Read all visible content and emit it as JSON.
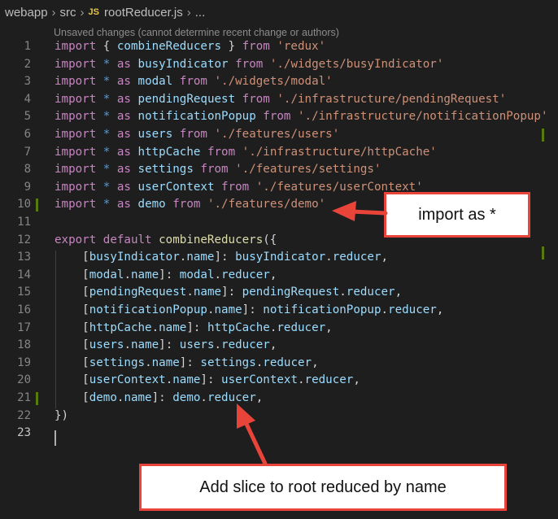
{
  "breadcrumb": {
    "items": [
      "webapp",
      "src",
      "rootReducer.js",
      "..."
    ],
    "file_icon": "JS"
  },
  "blame_text": "Unsaved changes (cannot determine recent change or authors)",
  "colors": {
    "background": "#1e1e1e",
    "keyword": "#c586c0",
    "builtin": "#569cd6",
    "string": "#ce9178",
    "variable": "#9cdcfe",
    "function": "#dcdcaa",
    "modified_gutter": "#587c0c",
    "callout_border": "#e8443a"
  },
  "lines": [
    {
      "n": "1",
      "tokens": [
        [
          "kw",
          "import"
        ],
        [
          "plain",
          " { "
        ],
        [
          "var",
          "combineReducers"
        ],
        [
          "plain",
          " } "
        ],
        [
          "kw",
          "from"
        ],
        [
          "plain",
          " "
        ],
        [
          "str",
          "'redux'"
        ]
      ]
    },
    {
      "n": "2",
      "tokens": [
        [
          "kw",
          "import"
        ],
        [
          "plain",
          " "
        ],
        [
          "blue",
          "*"
        ],
        [
          "plain",
          " "
        ],
        [
          "kw",
          "as"
        ],
        [
          "plain",
          " "
        ],
        [
          "var",
          "busyIndicator"
        ],
        [
          "plain",
          " "
        ],
        [
          "kw",
          "from"
        ],
        [
          "plain",
          " "
        ],
        [
          "str",
          "'./widgets/busyIndicator'"
        ]
      ]
    },
    {
      "n": "3",
      "tokens": [
        [
          "kw",
          "import"
        ],
        [
          "plain",
          " "
        ],
        [
          "blue",
          "*"
        ],
        [
          "plain",
          " "
        ],
        [
          "kw",
          "as"
        ],
        [
          "plain",
          " "
        ],
        [
          "var",
          "modal"
        ],
        [
          "plain",
          " "
        ],
        [
          "kw",
          "from"
        ],
        [
          "plain",
          " "
        ],
        [
          "str",
          "'./widgets/modal'"
        ]
      ]
    },
    {
      "n": "4",
      "tokens": [
        [
          "kw",
          "import"
        ],
        [
          "plain",
          " "
        ],
        [
          "blue",
          "*"
        ],
        [
          "plain",
          " "
        ],
        [
          "kw",
          "as"
        ],
        [
          "plain",
          " "
        ],
        [
          "var",
          "pendingRequest"
        ],
        [
          "plain",
          " "
        ],
        [
          "kw",
          "from"
        ],
        [
          "plain",
          " "
        ],
        [
          "str",
          "'./infrastructure/pendingRequest'"
        ]
      ]
    },
    {
      "n": "5",
      "tokens": [
        [
          "kw",
          "import"
        ],
        [
          "plain",
          " "
        ],
        [
          "blue",
          "*"
        ],
        [
          "plain",
          " "
        ],
        [
          "kw",
          "as"
        ],
        [
          "plain",
          " "
        ],
        [
          "var",
          "notificationPopup"
        ],
        [
          "plain",
          " "
        ],
        [
          "kw",
          "from"
        ],
        [
          "plain",
          " "
        ],
        [
          "str",
          "'./infrastructure/notificationPopup'"
        ]
      ]
    },
    {
      "n": "6",
      "tokens": [
        [
          "kw",
          "import"
        ],
        [
          "plain",
          " "
        ],
        [
          "blue",
          "*"
        ],
        [
          "plain",
          " "
        ],
        [
          "kw",
          "as"
        ],
        [
          "plain",
          " "
        ],
        [
          "var",
          "users"
        ],
        [
          "plain",
          " "
        ],
        [
          "kw",
          "from"
        ],
        [
          "plain",
          " "
        ],
        [
          "str",
          "'./features/users'"
        ]
      ]
    },
    {
      "n": "7",
      "tokens": [
        [
          "kw",
          "import"
        ],
        [
          "plain",
          " "
        ],
        [
          "blue",
          "*"
        ],
        [
          "plain",
          " "
        ],
        [
          "kw",
          "as"
        ],
        [
          "plain",
          " "
        ],
        [
          "var",
          "httpCache"
        ],
        [
          "plain",
          " "
        ],
        [
          "kw",
          "from"
        ],
        [
          "plain",
          " "
        ],
        [
          "str",
          "'./infrastructure/httpCache'"
        ]
      ]
    },
    {
      "n": "8",
      "tokens": [
        [
          "kw",
          "import"
        ],
        [
          "plain",
          " "
        ],
        [
          "blue",
          "*"
        ],
        [
          "plain",
          " "
        ],
        [
          "kw",
          "as"
        ],
        [
          "plain",
          " "
        ],
        [
          "var",
          "settings"
        ],
        [
          "plain",
          " "
        ],
        [
          "kw",
          "from"
        ],
        [
          "plain",
          " "
        ],
        [
          "str",
          "'./features/settings'"
        ]
      ]
    },
    {
      "n": "9",
      "tokens": [
        [
          "kw",
          "import"
        ],
        [
          "plain",
          " "
        ],
        [
          "blue",
          "*"
        ],
        [
          "plain",
          " "
        ],
        [
          "kw",
          "as"
        ],
        [
          "plain",
          " "
        ],
        [
          "var",
          "userContext"
        ],
        [
          "plain",
          " "
        ],
        [
          "kw",
          "from"
        ],
        [
          "plain",
          " "
        ],
        [
          "str",
          "'./features/userContext'"
        ]
      ]
    },
    {
      "n": "10",
      "modified": true,
      "tokens": [
        [
          "kw",
          "import"
        ],
        [
          "plain",
          " "
        ],
        [
          "blue",
          "*"
        ],
        [
          "plain",
          " "
        ],
        [
          "kw",
          "as"
        ],
        [
          "plain",
          " "
        ],
        [
          "var",
          "demo"
        ],
        [
          "plain",
          " "
        ],
        [
          "kw",
          "from"
        ],
        [
          "plain",
          " "
        ],
        [
          "str",
          "'./features/demo'"
        ]
      ]
    },
    {
      "n": "11",
      "tokens": []
    },
    {
      "n": "12",
      "tokens": [
        [
          "kw",
          "export"
        ],
        [
          "plain",
          " "
        ],
        [
          "kw",
          "default"
        ],
        [
          "plain",
          " "
        ],
        [
          "fn",
          "combineReducers"
        ],
        [
          "plain",
          "({"
        ]
      ]
    },
    {
      "n": "13",
      "tokens": [
        [
          "plain",
          "    ["
        ],
        [
          "var",
          "busyIndicator"
        ],
        [
          "plain",
          "."
        ],
        [
          "var",
          "name"
        ],
        [
          "plain",
          "]: "
        ],
        [
          "var",
          "busyIndicator"
        ],
        [
          "plain",
          "."
        ],
        [
          "var",
          "reducer"
        ],
        [
          "plain",
          ","
        ]
      ]
    },
    {
      "n": "14",
      "tokens": [
        [
          "plain",
          "    ["
        ],
        [
          "var",
          "modal"
        ],
        [
          "plain",
          "."
        ],
        [
          "var",
          "name"
        ],
        [
          "plain",
          "]: "
        ],
        [
          "var",
          "modal"
        ],
        [
          "plain",
          "."
        ],
        [
          "var",
          "reducer"
        ],
        [
          "plain",
          ","
        ]
      ]
    },
    {
      "n": "15",
      "tokens": [
        [
          "plain",
          "    ["
        ],
        [
          "var",
          "pendingRequest"
        ],
        [
          "plain",
          "."
        ],
        [
          "var",
          "name"
        ],
        [
          "plain",
          "]: "
        ],
        [
          "var",
          "pendingRequest"
        ],
        [
          "plain",
          "."
        ],
        [
          "var",
          "reducer"
        ],
        [
          "plain",
          ","
        ]
      ]
    },
    {
      "n": "16",
      "tokens": [
        [
          "plain",
          "    ["
        ],
        [
          "var",
          "notificationPopup"
        ],
        [
          "plain",
          "."
        ],
        [
          "var",
          "name"
        ],
        [
          "plain",
          "]: "
        ],
        [
          "var",
          "notificationPopup"
        ],
        [
          "plain",
          "."
        ],
        [
          "var",
          "reducer"
        ],
        [
          "plain",
          ","
        ]
      ]
    },
    {
      "n": "17",
      "tokens": [
        [
          "plain",
          "    ["
        ],
        [
          "var",
          "httpCache"
        ],
        [
          "plain",
          "."
        ],
        [
          "var",
          "name"
        ],
        [
          "plain",
          "]: "
        ],
        [
          "var",
          "httpCache"
        ],
        [
          "plain",
          "."
        ],
        [
          "var",
          "reducer"
        ],
        [
          "plain",
          ","
        ]
      ]
    },
    {
      "n": "18",
      "tokens": [
        [
          "plain",
          "    ["
        ],
        [
          "var",
          "users"
        ],
        [
          "plain",
          "."
        ],
        [
          "var",
          "name"
        ],
        [
          "plain",
          "]: "
        ],
        [
          "var",
          "users"
        ],
        [
          "plain",
          "."
        ],
        [
          "var",
          "reducer"
        ],
        [
          "plain",
          ","
        ]
      ]
    },
    {
      "n": "19",
      "tokens": [
        [
          "plain",
          "    ["
        ],
        [
          "var",
          "settings"
        ],
        [
          "plain",
          "."
        ],
        [
          "var",
          "name"
        ],
        [
          "plain",
          "]: "
        ],
        [
          "var",
          "settings"
        ],
        [
          "plain",
          "."
        ],
        [
          "var",
          "reducer"
        ],
        [
          "plain",
          ","
        ]
      ]
    },
    {
      "n": "20",
      "tokens": [
        [
          "plain",
          "    ["
        ],
        [
          "var",
          "userContext"
        ],
        [
          "plain",
          "."
        ],
        [
          "var",
          "name"
        ],
        [
          "plain",
          "]: "
        ],
        [
          "var",
          "userContext"
        ],
        [
          "plain",
          "."
        ],
        [
          "var",
          "reducer"
        ],
        [
          "plain",
          ","
        ]
      ]
    },
    {
      "n": "21",
      "modified": true,
      "tokens": [
        [
          "plain",
          "    ["
        ],
        [
          "var",
          "demo"
        ],
        [
          "plain",
          "."
        ],
        [
          "var",
          "name"
        ],
        [
          "plain",
          "]: "
        ],
        [
          "var",
          "demo"
        ],
        [
          "plain",
          "."
        ],
        [
          "var",
          "reducer"
        ],
        [
          "plain",
          ","
        ]
      ]
    },
    {
      "n": "22",
      "tokens": [
        [
          "plain",
          "})"
        ]
      ]
    },
    {
      "n": "23",
      "current": true,
      "tokens": []
    }
  ],
  "callouts": {
    "import_as": "import as *",
    "add_slice": "Add slice to root reduced by name"
  }
}
